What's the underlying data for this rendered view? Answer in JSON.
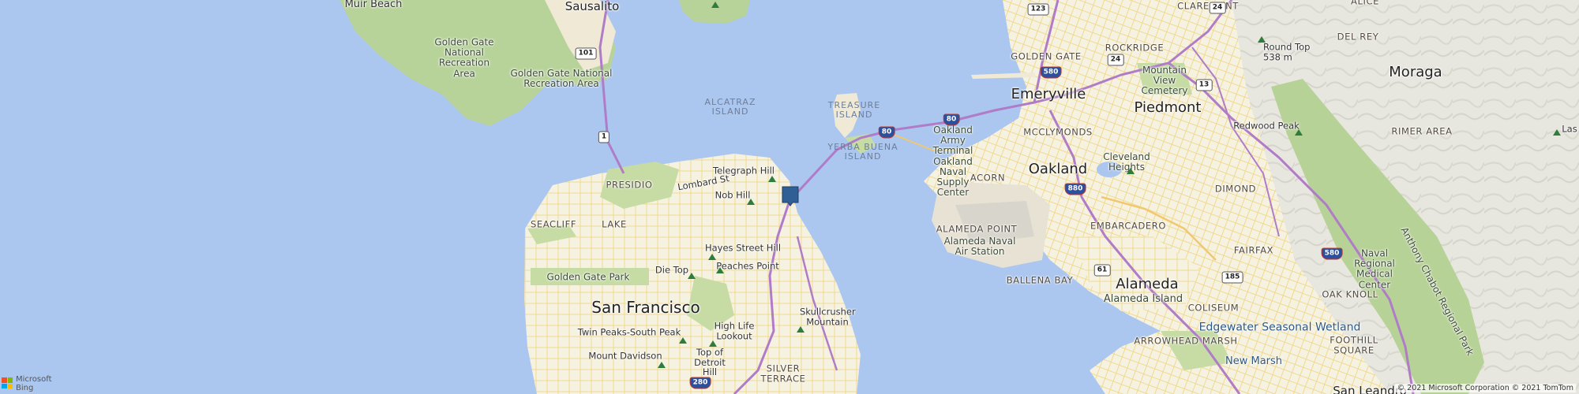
{
  "map": {
    "colors": {
      "water": "#abc6ef",
      "land": "#f5f1e4",
      "park": "#c6dca4",
      "hills": "#b9d39a",
      "highway": "#b07cc7",
      "road": "#f2d98c"
    },
    "cities": {
      "san_francisco": "San Francisco",
      "oakland": "Oakland",
      "emeryville": "Emeryville",
      "piedmont": "Piedmont",
      "alameda": "Alameda",
      "moraga": "Moraga",
      "sausalito": "Sausalito",
      "san_leandro": "San Leandro"
    },
    "areas": {
      "ggnra_1": "Golden Gate National Recreation Area",
      "ggnra_2": "Golden Gate National Recreation Area",
      "golden_gate_park": "Golden Gate Park",
      "muir_beach": "Muir Beach",
      "mountain_view_cemetery": "Mountain View Cemetery",
      "oakland_army": "Oakland Army Terminal Oakland Naval Supply Center",
      "alameda_naval": "Alameda Naval Air Station",
      "alameda_island": "Alameda Island",
      "naval_medical": "Naval Regional Medical Center",
      "anthony_chabot": "Anthony Chabot Regional Park",
      "cleveland_heights": "Cleveland Heights"
    },
    "islands": {
      "alcatraz": "ALCATRAZ ISLAND",
      "treasure": "TREASURE ISLAND",
      "yerba_buena": "YERBA BUENA ISLAND"
    },
    "neighborhoods": {
      "presidio": "PRESIDIO",
      "seacliff": "SEACLIFF",
      "lake": "LAKE",
      "silver_terrace": "SILVER TERRACE",
      "golden_gate": "GOLDEN GATE",
      "rockridge": "ROCKRIDGE",
      "claremont": "CLAREMONT",
      "del_rey": "DEL REY",
      "alice": "ALICE",
      "mcclymonds": "MCCLYMONDS",
      "acorn": "ACORN",
      "dimond": "DIMOND",
      "embarcadero": "EMBARCADERO",
      "fairfax": "FAIRFAX",
      "alameda_point": "ALAMEDA POINT",
      "ballena_bay": "BALLENA BAY",
      "coliseum": "COLISEUM",
      "oak_knoll": "OAK KNOLL",
      "foothill_square": "FOOTHILL SQUARE",
      "arrowhead_marsh": "ARROWHEAD MARSH",
      "rimer_area": "RIMER AREA"
    },
    "pois": {
      "telegraph_hill": "Telegraph Hill",
      "nob_hill": "Nob Hill",
      "hayes_street_hill": "Hayes Street Hill",
      "die_top": "Die Top",
      "peaches_point": "Peaches Point",
      "twin_peaks": "Twin Peaks-South Peak",
      "high_life": "High Life Lookout",
      "mount_davidson": "Mount Davidson",
      "top_of_detroit": "Top of Detroit Hill",
      "skullcrusher": "Skullcrusher Mountain",
      "round_top": "Round Top 538 m",
      "redwood_peak": "Redwood Peak",
      "lombard": "Lombard St",
      "las": "Las"
    },
    "water_features": {
      "edgewater": "Edgewater Seasonal Wetland",
      "new_marsh": "New Marsh"
    },
    "shields": {
      "us101": "101",
      "ca1": "1",
      "i80a": "80",
      "i80b": "80",
      "i580": "580",
      "ca123": "123",
      "ca24a": "24",
      "ca24b": "24",
      "ca13": "13",
      "i880": "880",
      "ca61": "61",
      "ca185": "185",
      "i580b": "580",
      "i280": "280"
    },
    "marker_color": "#2f5f94"
  },
  "attribution": {
    "logo_text_1": "Microsoft",
    "logo_text_2": "Bing",
    "copyright": "© 2021 Microsoft Corporation © 2021 TomTom"
  }
}
